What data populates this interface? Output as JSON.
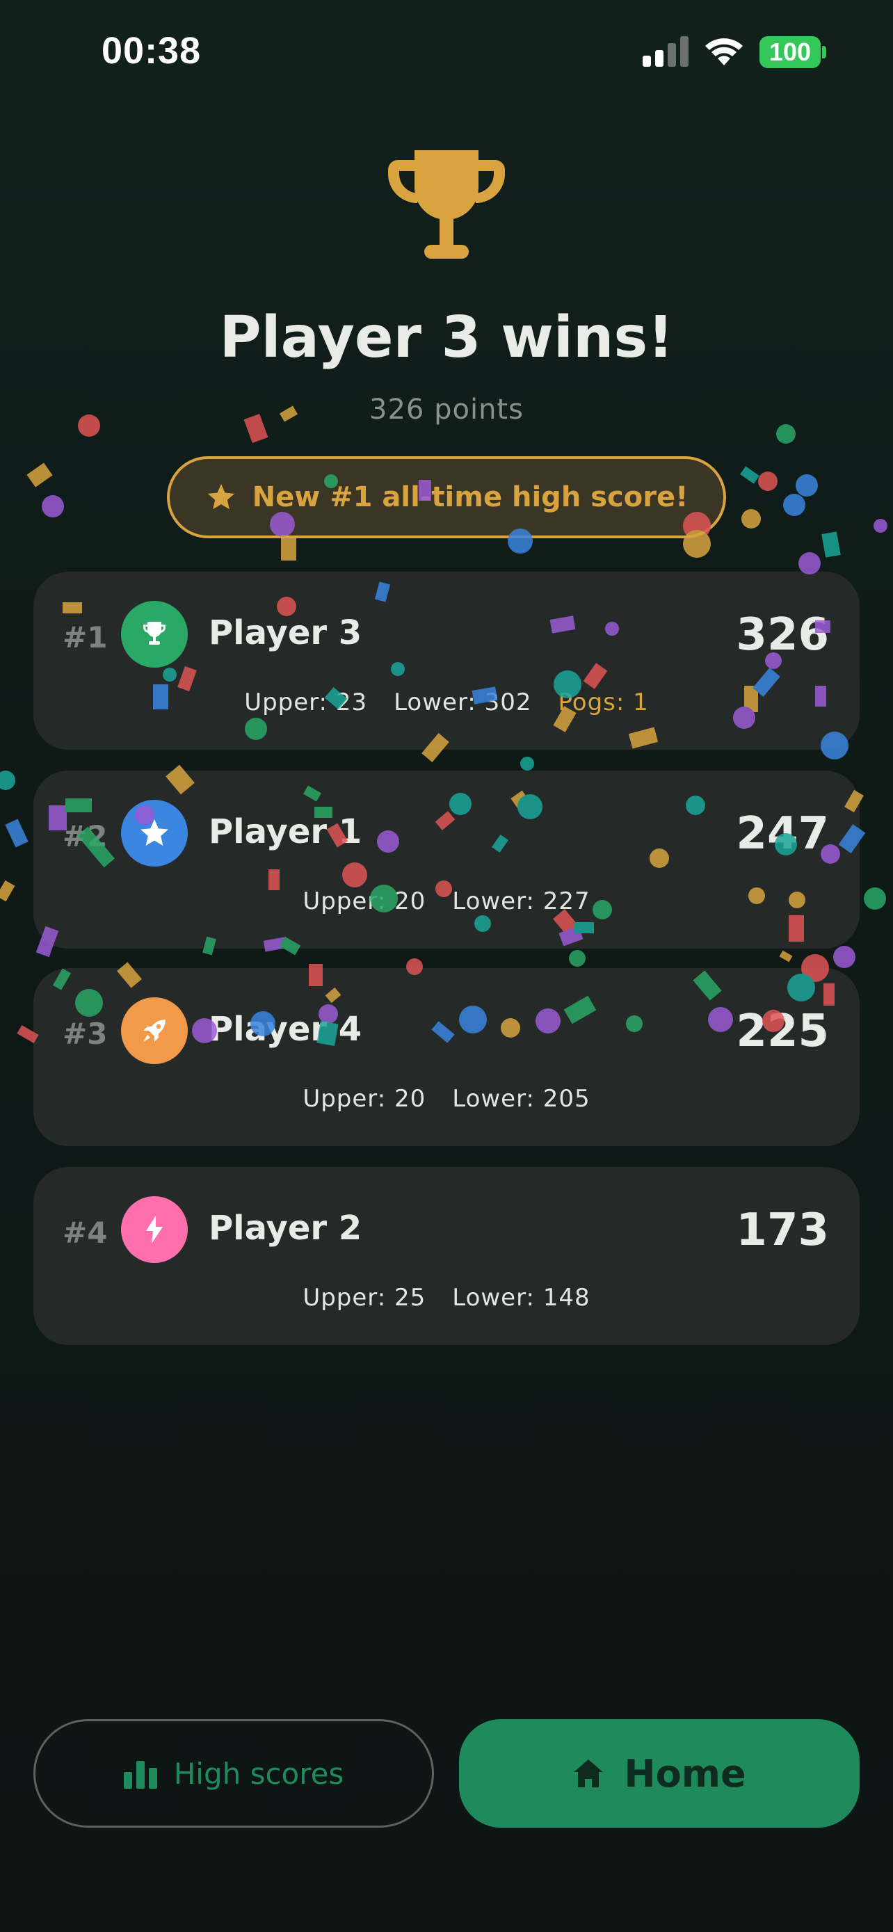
{
  "status_bar": {
    "time": "00:38",
    "battery": "100"
  },
  "result": {
    "title": "Player 3 wins!",
    "points": "326 points",
    "record": "New #1 all-time high score!"
  },
  "leaderboard": [
    {
      "rank": "#1",
      "name": "Player 3",
      "score": "326",
      "upper": "Upper: 23",
      "lower": "Lower: 302",
      "pogs": "Pogs: 1",
      "icon": "trophy-icon",
      "color": "#2aa866"
    },
    {
      "rank": "#2",
      "name": "Player 1",
      "score": "247",
      "upper": "Upper: 20",
      "lower": "Lower: 227",
      "icon": "star-icon",
      "color": "#3a86e0"
    },
    {
      "rank": "#3",
      "name": "Player 4",
      "score": "225",
      "upper": "Upper: 20",
      "lower": "Lower: 205",
      "icon": "rocket-icon",
      "color": "#f2994a"
    },
    {
      "rank": "#4",
      "name": "Player 2",
      "score": "173",
      "upper": "Upper: 25",
      "lower": "Lower: 148",
      "icon": "bolt-icon",
      "color": "#ff6fae"
    }
  ],
  "buttons": {
    "high_scores": "High scores",
    "home": "Home"
  },
  "colors": {
    "accent_gold": "#d9a440",
    "accent_green": "#1f8a5c",
    "card_bg": "#252927"
  }
}
